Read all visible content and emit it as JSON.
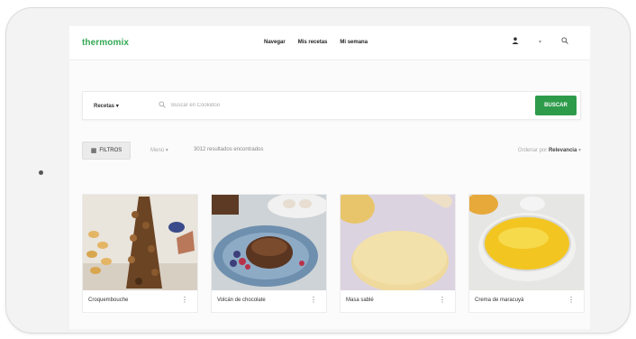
{
  "nav": {
    "logo": "thermomix",
    "links": [
      "Navegar",
      "Mis recetas",
      "Mi semana"
    ],
    "icons": [
      "user-icon",
      "chevron-down-icon",
      "search-icon"
    ]
  },
  "search": {
    "category": "Recetas",
    "placeholder": "Buscar en Cookidoo",
    "button": "BUSCAR"
  },
  "filters": {
    "button": "FILTROS",
    "menu": "Menú",
    "results": "3012 resultados encontrados",
    "sort_label": "Ordenar por",
    "sort_value": "Relevancia"
  },
  "recipes": [
    {
      "title": "Croquembouche"
    },
    {
      "title": "Volcán de chocolate"
    },
    {
      "title": "Masa sablé"
    },
    {
      "title": "Crema de maracuyá"
    }
  ],
  "colors": {
    "brand": "#34a853",
    "button": "#2e9b4a"
  }
}
